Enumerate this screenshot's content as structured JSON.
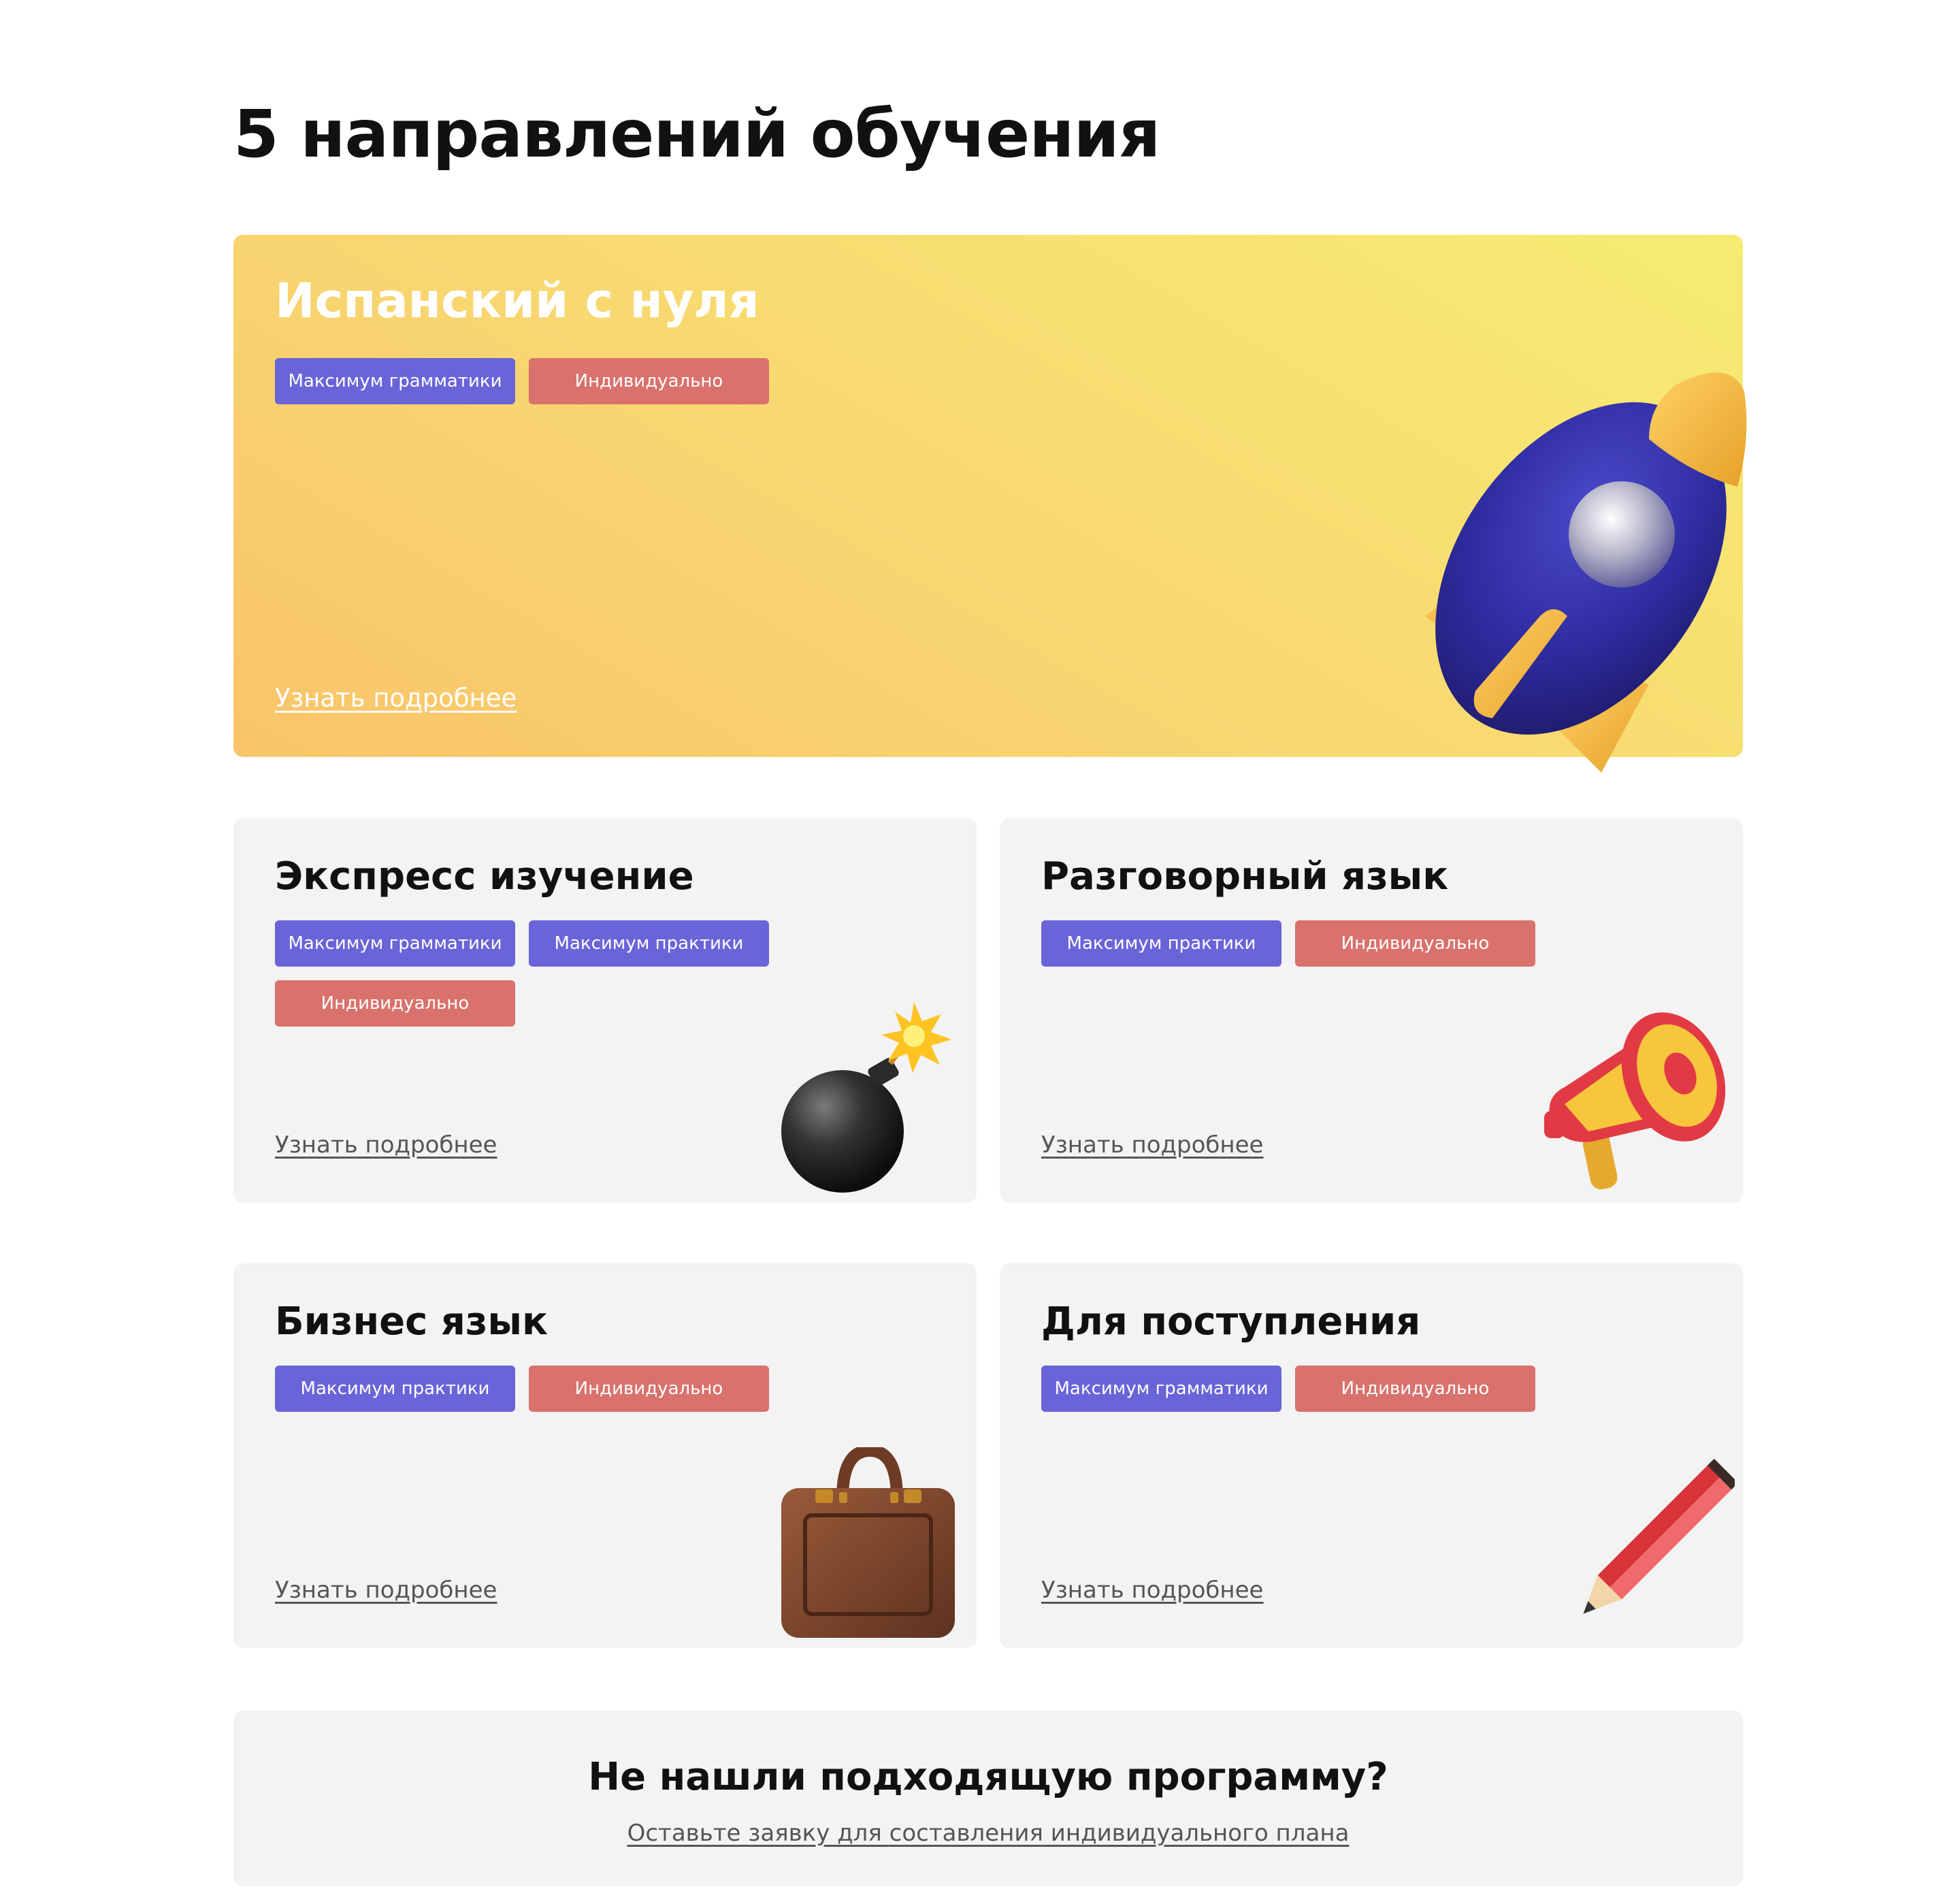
{
  "page": {
    "title": "5 направлений обучения"
  },
  "hero": {
    "title": "Испанский с нуля",
    "tags": [
      "Максимум грамматики",
      "Индивидуально"
    ],
    "link": "Узнать подробнее",
    "icon": "rocket-icon",
    "colors": {
      "gradient_from": "#f9c46a",
      "gradient_to": "#f6ec72"
    }
  },
  "cards": [
    {
      "title": "Экспресс изучение",
      "tags": [
        "Максимум грамматики",
        "Максимум практики",
        "Индивидуально"
      ],
      "link": "Узнать подробнее",
      "icon": "bomb-icon"
    },
    {
      "title": "Разговорный язык",
      "tags": [
        "Максимум практики",
        "Индивидуально"
      ],
      "link": "Узнать подробнее",
      "icon": "megaphone-icon"
    },
    {
      "title": "Бизнес язык",
      "tags": [
        "Максимум практики",
        "Индивидуально"
      ],
      "link": "Узнать подробнее",
      "icon": "briefcase-icon"
    },
    {
      "title": "Для поступления",
      "tags": [
        "Максимум грамматики",
        "Индивидуально"
      ],
      "link": "Узнать подробнее",
      "icon": "pencil-icon"
    }
  ],
  "cta": {
    "title": "Не нашли подходящую программу?",
    "link": "Оставьте заявку для составления индивидуального плана"
  },
  "colors": {
    "tag_blue": "#6a64d9",
    "tag_red": "#d9716c",
    "card_bg": "#f3f3f3"
  }
}
